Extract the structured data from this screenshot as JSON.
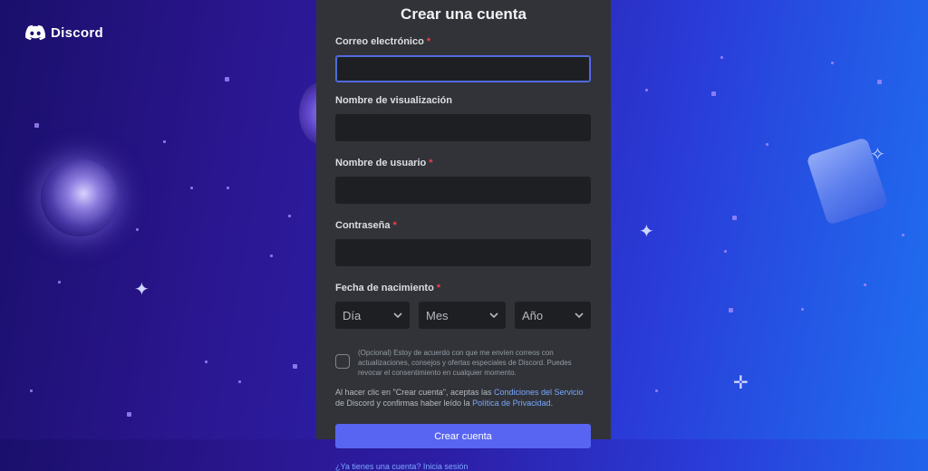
{
  "brand": {
    "name": "Discord",
    "icon": "discord-logo-icon",
    "accent": "#5865f2"
  },
  "form": {
    "title": "Crear una cuenta",
    "email": {
      "label": "Correo electrónico",
      "required": "*",
      "value": ""
    },
    "display_name": {
      "label": "Nombre de visualización",
      "value": ""
    },
    "username": {
      "label": "Nombre de usuario",
      "required": "*",
      "value": ""
    },
    "password": {
      "label": "Contraseña",
      "required": "*",
      "value": ""
    },
    "birthdate": {
      "label": "Fecha de nacimiento",
      "required": "*",
      "day": "Día",
      "month": "Mes",
      "year": "Año"
    },
    "optin": "(Opcional) Estoy de acuerdo con que me envíen correos con actualizaciones, consejos y ofertas especiales de Discord. Puedes revocar el consentimiento en cualquier momento.",
    "terms": {
      "prefix": "Al hacer clic en \"Crear cuenta\", aceptas las ",
      "tos_link": "Condiciones del Servicio",
      "middle": " de Discord y confirmas haber leído la ",
      "privacy_link": "Política de Privacidad",
      "suffix": "."
    },
    "submit": "Crear cuenta",
    "login_link": "¿Ya tienes una cuenta? Inicia sesión"
  }
}
